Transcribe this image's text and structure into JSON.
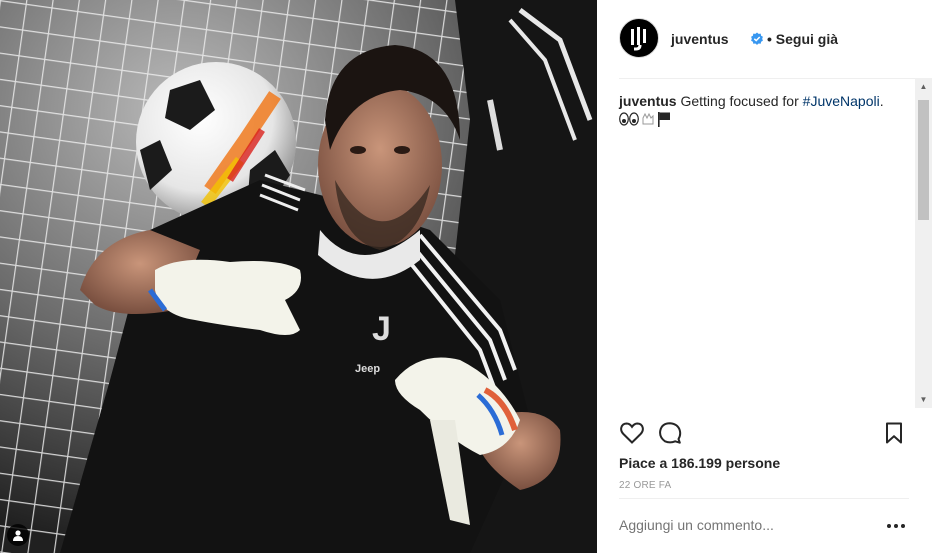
{
  "post": {
    "username": "juventus",
    "follow_status": "• Segui già",
    "caption_username": "juventus",
    "caption_text": " Getting focused for ",
    "hashtag": "#JuveNapoli",
    "caption_end": ".",
    "likes": "Piace a 186.199 persone",
    "time": "22 ORE FA",
    "comment_placeholder": "Aggiungi un commento..."
  },
  "icons": {
    "verified": "verified-badge-icon",
    "like": "heart-icon",
    "comment": "comment-icon",
    "save": "bookmark-icon",
    "more": "more-options-icon",
    "user_tag": "user-tag-icon",
    "emojis": [
      "eyes-emoji",
      "goalkeeper-glove-emoji",
      "black-flag-emoji"
    ]
  },
  "colors": {
    "verified": "#3897f0",
    "hashtag": "#003569",
    "muted": "#999999",
    "divider": "#efefef"
  }
}
